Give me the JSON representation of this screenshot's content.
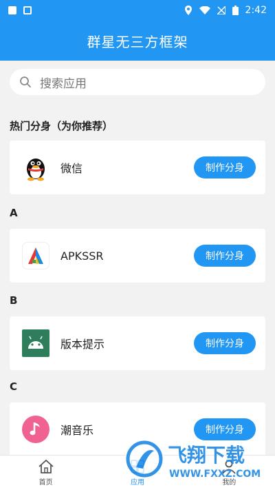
{
  "status_bar": {
    "time": "2:42"
  },
  "header": {
    "title": "群星无三方框架"
  },
  "search": {
    "placeholder": "搜索应用"
  },
  "sections": [
    {
      "label": "热门分身（为你推荐）",
      "apps": [
        {
          "name": "微信",
          "icon": "penguin-icon",
          "button": "制作分身"
        }
      ]
    },
    {
      "label": "A",
      "apps": [
        {
          "name": "APKSSR",
          "icon": "apkssr-logo-icon",
          "button": "制作分身"
        }
      ]
    },
    {
      "label": "B",
      "apps": [
        {
          "name": "版本提示",
          "icon": "android-icon",
          "button": "制作分身"
        }
      ]
    },
    {
      "label": "C",
      "apps": [
        {
          "name": "潮音乐",
          "icon": "music-note-icon",
          "button": "制作分身"
        }
      ]
    }
  ],
  "bottom_nav": [
    {
      "label": "首页",
      "icon": "home-icon",
      "active": false
    },
    {
      "label": "应用",
      "icon": "apps-icon",
      "active": true
    },
    {
      "label": "我的",
      "icon": "profile-icon",
      "active": false
    }
  ],
  "watermark": {
    "text_cn": "飞翔下载",
    "url": "WWW.FXXZ.COM"
  },
  "colors": {
    "primary": "#2196f3",
    "background": "#f2f2f2"
  }
}
